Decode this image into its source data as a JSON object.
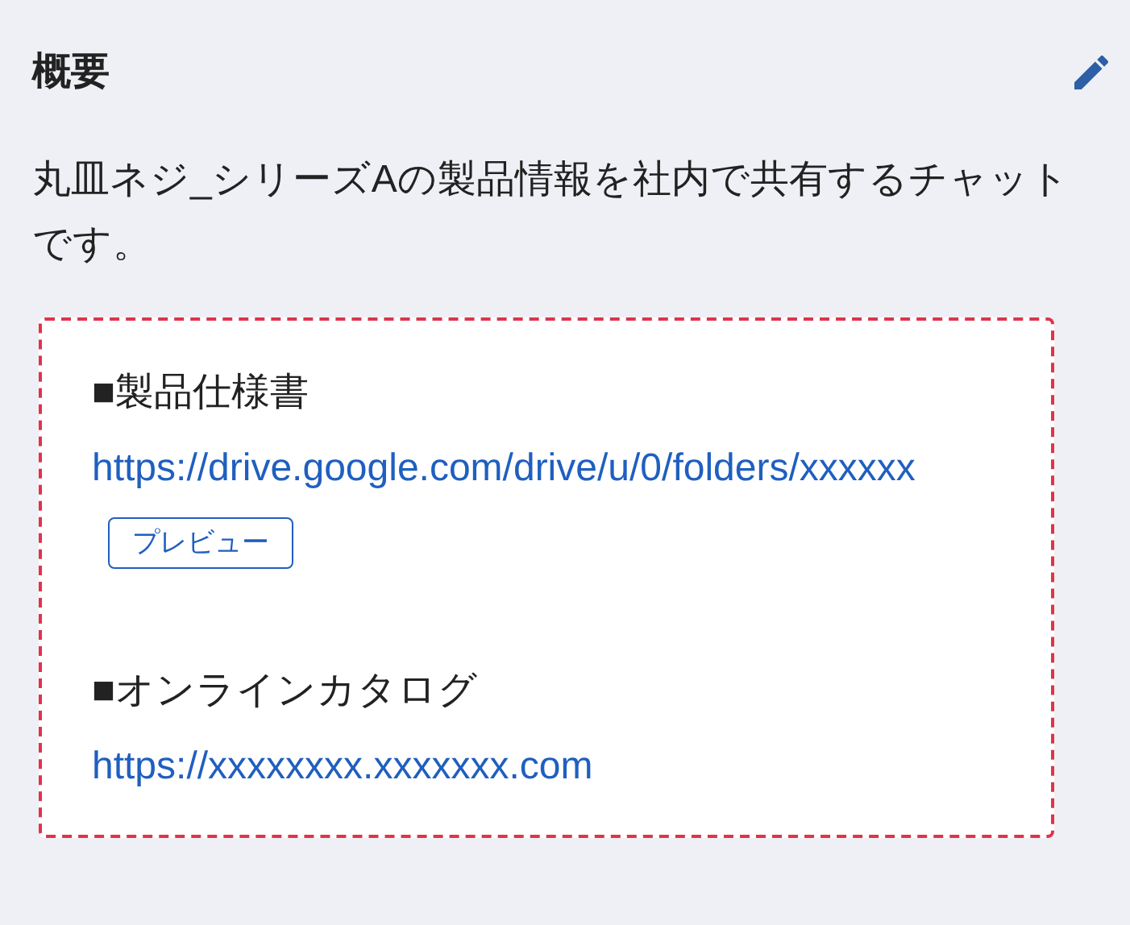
{
  "section": {
    "title": "概要",
    "description": "丸皿ネジ_シリーズAの製品情報を社内で共有するチャットです。"
  },
  "links": [
    {
      "heading": "■製品仕様書",
      "url": "https://drive.google.com/drive/u/0/folders/xxxxxx",
      "button": "プレビュー"
    },
    {
      "heading": "■オンラインカタログ",
      "url": "https://xxxxxxxx.xxxxxxx.com"
    }
  ]
}
